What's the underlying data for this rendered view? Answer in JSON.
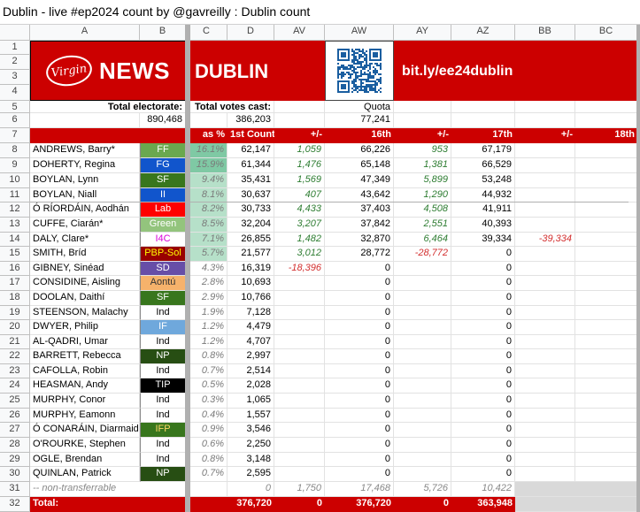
{
  "window_title": "Dublin - live #ep2024 count by @gavreilly : Dublin count",
  "col_letters": [
    "A",
    "B",
    "C",
    "D",
    "AV",
    "AW",
    "AY",
    "AZ",
    "BB",
    "BC"
  ],
  "banner": {
    "virgin": "Virgin media",
    "news": "NEWS",
    "constituency": "DUBLIN",
    "link": "bit.ly/ee24dublin",
    "qr": "qr-code"
  },
  "labels": {
    "total_electorate": "Total electorate:",
    "electorate": "890,468",
    "total_votes": "Total votes cast:",
    "votes": "386,203",
    "quota_label": "Quota",
    "quota": "77,241"
  },
  "headers": {
    "as_pct": "as %",
    "first": "1st Count",
    "pm1": "+/-",
    "c16": "16th",
    "pm2": "+/-",
    "c17": "17th",
    "pm3": "+/-",
    "c18": "18th"
  },
  "candidates": [
    {
      "name": "ANDREWS, Barry*",
      "party": "FF",
      "pct": "16.1%",
      "c1": "62,147",
      "d1": "1,059",
      "c16": "66,226",
      "d2": "953",
      "c17": "67,179",
      "d3": ""
    },
    {
      "name": "DOHERTY, Regina",
      "party": "FG",
      "pct": "15.9%",
      "c1": "61,344",
      "d1": "1,476",
      "c16": "65,148",
      "d2": "1,381",
      "c17": "66,529",
      "d3": ""
    },
    {
      "name": "BOYLAN, Lynn",
      "party": "SF",
      "pct": "9.4%",
      "c1": "35,431",
      "d1": "1,569",
      "c16": "47,349",
      "d2": "5,899",
      "c17": "53,248",
      "d3": ""
    },
    {
      "name": "BOYLAN, Niall",
      "party": "II",
      "pct": "8.1%",
      "c1": "30,637",
      "d1": "407",
      "c16": "43,642",
      "d2": "1,290",
      "c17": "44,932",
      "d3": ""
    },
    {
      "name": "Ó RÍORDÁIN, Aodhán",
      "party": "Lab",
      "pct": "8.2%",
      "c1": "30,733",
      "d1": "4,433",
      "c16": "37,403",
      "d2": "4,508",
      "c17": "41,911",
      "d3": ""
    },
    {
      "name": "CUFFE, Ciarán*",
      "party": "Green",
      "pct": "8.5%",
      "c1": "32,204",
      "d1": "3,207",
      "c16": "37,842",
      "d2": "2,551",
      "c17": "40,393",
      "d3": ""
    },
    {
      "name": "DALY, Clare*",
      "party": "I4C",
      "pct": "7.1%",
      "c1": "26,855",
      "d1": "1,482",
      "c16": "32,870",
      "d2": "6,464",
      "c17": "39,334",
      "d3": "-39,334"
    },
    {
      "name": "SMITH, Bríd",
      "party": "PBP-Sol",
      "pct": "5.7%",
      "c1": "21,577",
      "d1": "3,012",
      "c16": "28,772",
      "d2": "-28,772",
      "c17": "0",
      "d3": ""
    },
    {
      "name": "GIBNEY, Sinéad",
      "party": "SD",
      "pct": "4.3%",
      "c1": "16,319",
      "d1": "-18,396",
      "c16": "0",
      "d2": "",
      "c17": "0",
      "d3": ""
    },
    {
      "name": "CONSIDINE, Aisling",
      "party": "Aontú",
      "pct": "2.8%",
      "c1": "10,693",
      "d1": "",
      "c16": "0",
      "d2": "",
      "c17": "0",
      "d3": ""
    },
    {
      "name": "DOOLAN, Daithí",
      "party": "SF",
      "pct": "2.9%",
      "c1": "10,766",
      "d1": "",
      "c16": "0",
      "d2": "",
      "c17": "0",
      "d3": ""
    },
    {
      "name": "STEENSON, Malachy",
      "party": "Ind",
      "pct": "1.9%",
      "c1": "7,128",
      "d1": "",
      "c16": "0",
      "d2": "",
      "c17": "0",
      "d3": ""
    },
    {
      "name": "DWYER, Philip",
      "party": "IF",
      "pct": "1.2%",
      "c1": "4,479",
      "d1": "",
      "c16": "0",
      "d2": "",
      "c17": "0",
      "d3": ""
    },
    {
      "name": "AL-QADRI, Umar",
      "party": "Ind",
      "pct": "1.2%",
      "c1": "4,707",
      "d1": "",
      "c16": "0",
      "d2": "",
      "c17": "0",
      "d3": ""
    },
    {
      "name": "BARRETT, Rebecca",
      "party": "NP",
      "pct": "0.8%",
      "c1": "2,997",
      "d1": "",
      "c16": "0",
      "d2": "",
      "c17": "0",
      "d3": ""
    },
    {
      "name": "CAFOLLA, Robin",
      "party": "Ind",
      "pct": "0.7%",
      "c1": "2,514",
      "d1": "",
      "c16": "0",
      "d2": "",
      "c17": "0",
      "d3": ""
    },
    {
      "name": "HEASMAN, Andy",
      "party": "TIP",
      "pct": "0.5%",
      "c1": "2,028",
      "d1": "",
      "c16": "0",
      "d2": "",
      "c17": "0",
      "d3": ""
    },
    {
      "name": "MURPHY, Conor",
      "party": "Ind",
      "pct": "0.3%",
      "c1": "1,065",
      "d1": "",
      "c16": "0",
      "d2": "",
      "c17": "0",
      "d3": ""
    },
    {
      "name": "MURPHY, Eamonn",
      "party": "Ind",
      "pct": "0.4%",
      "c1": "1,557",
      "d1": "",
      "c16": "0",
      "d2": "",
      "c17": "0",
      "d3": ""
    },
    {
      "name": "Ó CONARÁIN, Diarmaid",
      "party": "IFP",
      "pct": "0.9%",
      "c1": "3,546",
      "d1": "",
      "c16": "0",
      "d2": "",
      "c17": "0",
      "d3": ""
    },
    {
      "name": "O'ROURKE, Stephen",
      "party": "Ind",
      "pct": "0.6%",
      "c1": "2,250",
      "d1": "",
      "c16": "0",
      "d2": "",
      "c17": "0",
      "d3": ""
    },
    {
      "name": "OGLE, Brendan",
      "party": "Ind",
      "pct": "0.8%",
      "c1": "3,148",
      "d1": "",
      "c16": "0",
      "d2": "",
      "c17": "0",
      "d3": ""
    },
    {
      "name": "QUINLAN, Patrick",
      "party": "NP",
      "pct": "0.7%",
      "c1": "2,595",
      "d1": "",
      "c16": "0",
      "d2": "",
      "c17": "0",
      "d3": ""
    }
  ],
  "party_colors": {
    "FF": "#6aa84f",
    "FG": "#1155cc",
    "SF": "#38761d",
    "II": "#1155cc",
    "Lab": "#ff0000",
    "Green": "#93c47d",
    "I4C": "#ffffff",
    "PBP-Sol": "#990000",
    "SD": "#674ea7",
    "Aontú": "#f6b26b",
    "Ind": "#ffffff",
    "IF": "#6fa8dc",
    "NP": "#274e13",
    "TIP": "#000000",
    "IFP": "#38761d"
  },
  "party_text": {
    "FF": "#ffffff",
    "FG": "#ffffff",
    "SF": "#ffffff",
    "II": "#ffffff",
    "Lab": "#ffffff",
    "Green": "#ffffff",
    "I4C": "#d900d9",
    "PBP-Sol": "#ffff00",
    "SD": "#ffffff",
    "Aontú": "#333333",
    "Ind": "#000000",
    "IF": "#ffffff",
    "NP": "#ffffff",
    "TIP": "#ffffff",
    "IFP": "#ffd966"
  },
  "nontransfer": {
    "label": "-- non-transferrable",
    "c1": "0",
    "d1": "1,750",
    "c16": "17,468",
    "d2": "5,726",
    "c17": "10,422"
  },
  "total": {
    "label": "Total:",
    "c1": "376,720",
    "d1": "0",
    "c16": "376,720",
    "d2": "0",
    "c17": "363,948"
  }
}
